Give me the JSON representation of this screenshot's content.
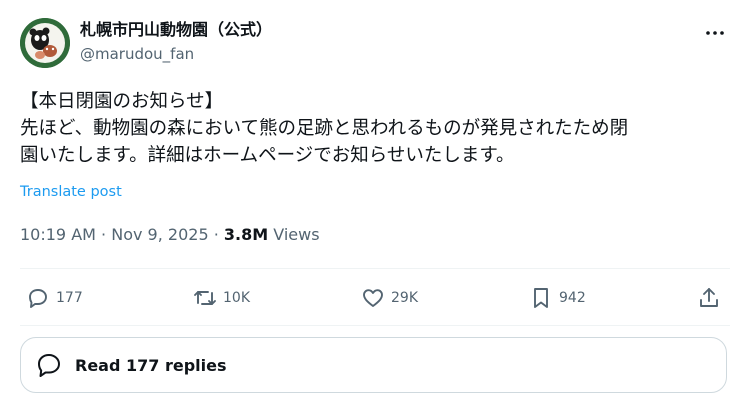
{
  "author": {
    "display_name": "札幌市円山動物園（公式）",
    "handle": "@marudou_fan",
    "avatar_icon": "zoo-logo-icon"
  },
  "post": {
    "line1": "【本日閉園のお知らせ】",
    "line2": "先ほど、動物園の森において熊の足跡と思われるものが発見されたため閉",
    "line3": "園いたします。詳細はホームページでお知らせいたします。",
    "translate_label": "Translate post"
  },
  "meta": {
    "time": "10:19 AM",
    "sep1": "·",
    "date": "Nov 9, 2025",
    "sep2": "·",
    "views_count": "3.8M",
    "views_label": "Views"
  },
  "actions": {
    "replies": "177",
    "reposts": "10K",
    "likes": "29K",
    "bookmarks": "942"
  },
  "read_replies": {
    "label": "Read 177 replies"
  },
  "colors": {
    "text": "#0f1419",
    "secondary": "#536471",
    "link": "#1d9bf0",
    "border": "#cfd9de",
    "avatar_bg": "#2f6b3a"
  },
  "icons": [
    "more-icon",
    "reply-icon",
    "repost-icon",
    "like-icon",
    "bookmark-icon",
    "share-icon",
    "replies-bubble-icon"
  ]
}
